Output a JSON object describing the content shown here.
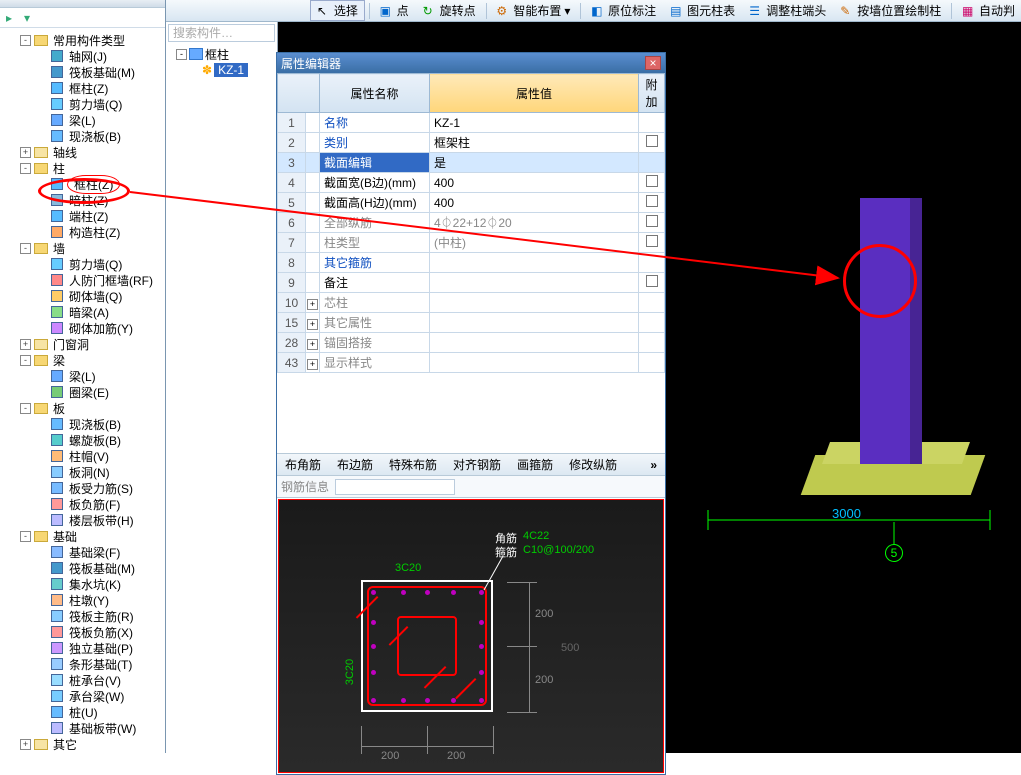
{
  "toolbar": {
    "select": "选择",
    "point": "点",
    "rotpoint": "旋转点",
    "smart": "智能布置",
    "origin": "原位标注",
    "metalist": "图元柱表",
    "adjust": "调整柱端头",
    "drawcol": "按墙位置绘制柱",
    "auto": "自动判"
  },
  "tree": [
    {
      "d": 1,
      "exp": "-",
      "ico": "fold-y",
      "lbl": "常用构件类型"
    },
    {
      "d": 2,
      "ico": "grid-b",
      "lbl": "轴网(J)"
    },
    {
      "d": 2,
      "ico": "raft-b",
      "lbl": "筏板基础(M)"
    },
    {
      "d": 2,
      "ico": "col-b",
      "lbl": "框柱(Z)"
    },
    {
      "d": 2,
      "ico": "wall-b",
      "lbl": "剪力墙(Q)"
    },
    {
      "d": 2,
      "ico": "beam-b",
      "lbl": "梁(L)"
    },
    {
      "d": 2,
      "ico": "slab-b",
      "lbl": "现浇板(B)"
    },
    {
      "d": 1,
      "exp": "+",
      "ico": "fold-c",
      "lbl": "轴线"
    },
    {
      "d": 1,
      "exp": "-",
      "ico": "fold-y",
      "lbl": "柱"
    },
    {
      "d": 2,
      "ico": "col-b",
      "lbl": "框柱(Z)",
      "hi": true
    },
    {
      "d": 2,
      "ico": "col-g",
      "lbl": "暗柱(Z)"
    },
    {
      "d": 2,
      "ico": "col-b",
      "lbl": "端柱(Z)"
    },
    {
      "d": 2,
      "ico": "col-o",
      "lbl": "构造柱(Z)"
    },
    {
      "d": 1,
      "exp": "-",
      "ico": "fold-y",
      "lbl": "墙"
    },
    {
      "d": 2,
      "ico": "wall-b",
      "lbl": "剪力墙(Q)"
    },
    {
      "d": 2,
      "ico": "wall-r",
      "lbl": "人防门框墙(RF)"
    },
    {
      "d": 2,
      "ico": "wall-y",
      "lbl": "砌体墙(Q)"
    },
    {
      "d": 2,
      "ico": "wall-g",
      "lbl": "暗梁(A)"
    },
    {
      "d": 2,
      "ico": "wall-p",
      "lbl": "砌体加筋(Y)"
    },
    {
      "d": 1,
      "exp": "+",
      "ico": "fold-c",
      "lbl": "门窗洞"
    },
    {
      "d": 1,
      "exp": "-",
      "ico": "fold-y",
      "lbl": "梁"
    },
    {
      "d": 2,
      "ico": "beam-b",
      "lbl": "梁(L)"
    },
    {
      "d": 2,
      "ico": "beam-g",
      "lbl": "圈梁(E)"
    },
    {
      "d": 1,
      "exp": "-",
      "ico": "fold-y",
      "lbl": "板"
    },
    {
      "d": 2,
      "ico": "slab-b",
      "lbl": "现浇板(B)"
    },
    {
      "d": 2,
      "ico": "slab-c",
      "lbl": "螺旋板(B)"
    },
    {
      "d": 2,
      "ico": "slab-h",
      "lbl": "柱帽(V)"
    },
    {
      "d": 2,
      "ico": "slab-o",
      "lbl": "板洞(N)"
    },
    {
      "d": 2,
      "ico": "slab-r",
      "lbl": "板受力筋(S)"
    },
    {
      "d": 2,
      "ico": "slab-n",
      "lbl": "板负筋(F)"
    },
    {
      "d": 2,
      "ico": "slab-s",
      "lbl": "楼层板带(H)"
    },
    {
      "d": 1,
      "exp": "-",
      "ico": "fold-y",
      "lbl": "基础"
    },
    {
      "d": 2,
      "ico": "fnd-b",
      "lbl": "基础梁(F)"
    },
    {
      "d": 2,
      "ico": "raft-b",
      "lbl": "筏板基础(M)"
    },
    {
      "d": 2,
      "ico": "fnd-s",
      "lbl": "集水坑(K)"
    },
    {
      "d": 2,
      "ico": "fnd-p",
      "lbl": "柱墩(Y)"
    },
    {
      "d": 2,
      "ico": "fnd-m",
      "lbl": "筏板主筋(R)"
    },
    {
      "d": 2,
      "ico": "fnd-n",
      "lbl": "筏板负筋(X)"
    },
    {
      "d": 2,
      "ico": "fnd-i",
      "lbl": "独立基础(P)"
    },
    {
      "d": 2,
      "ico": "fnd-t",
      "lbl": "条形基础(T)"
    },
    {
      "d": 2,
      "ico": "fnd-c",
      "lbl": "桩承台(V)"
    },
    {
      "d": 2,
      "ico": "fnd-cb",
      "lbl": "承台梁(W)"
    },
    {
      "d": 2,
      "ico": "fnd-z",
      "lbl": "桩(U)"
    },
    {
      "d": 2,
      "ico": "fnd-bd",
      "lbl": "基础板带(W)"
    },
    {
      "d": 1,
      "exp": "+",
      "ico": "fold-c",
      "lbl": "其它"
    }
  ],
  "mid": {
    "search_ph": "搜索构件…",
    "root": "框柱",
    "item": "KZ-1"
  },
  "prop": {
    "title": "属性编辑器",
    "h_name": "属性名称",
    "h_val": "属性值",
    "h_add": "附加",
    "rows": [
      {
        "n": "1",
        "name": "名称",
        "val": "KZ-1",
        "link": true
      },
      {
        "n": "2",
        "name": "类别",
        "val": "框架柱",
        "link": true,
        "chk": true
      },
      {
        "n": "3",
        "name": "截面编辑",
        "val": "是",
        "sel": true
      },
      {
        "n": "4",
        "name": "截面宽(B边)(mm)",
        "val": "400",
        "chk": true
      },
      {
        "n": "5",
        "name": "截面高(H边)(mm)",
        "val": "400",
        "chk": true
      },
      {
        "n": "6",
        "name": "全部纵筋",
        "val": "4⏀22+12⏀20",
        "grey": true,
        "chk": true
      },
      {
        "n": "7",
        "name": "柱类型",
        "val": "(中柱)",
        "grey": true,
        "chk": true
      },
      {
        "n": "8",
        "name": "其它箍筋",
        "val": "",
        "link": true
      },
      {
        "n": "9",
        "name": "备注",
        "val": "",
        "chk": true
      },
      {
        "n": "10",
        "name": "芯柱",
        "val": "",
        "xc": "+",
        "grey": true
      },
      {
        "n": "15",
        "name": "其它属性",
        "val": "",
        "xc": "+",
        "grey": true
      },
      {
        "n": "28",
        "name": "锚固搭接",
        "val": "",
        "xc": "+",
        "grey": true
      },
      {
        "n": "43",
        "name": "显示样式",
        "val": "",
        "xc": "+",
        "grey": true
      }
    ]
  },
  "section": {
    "tabs": [
      "布角筋",
      "布边筋",
      "特殊布筋",
      "对齐钢筋",
      "画箍筋",
      "修改纵筋"
    ],
    "info_lbl": "钢筋信息",
    "jiao": "角筋",
    "jiao_v": "4C22",
    "gu": "箍筋",
    "gu_v": "C10@100/200",
    "top_dim": "3C20",
    "left_dim": "3C20",
    "d200a": "200",
    "d200b": "200",
    "d200c": "200",
    "d200d": "200",
    "d500": "500"
  },
  "canvas": {
    "dim": "3000",
    "axis": "5"
  }
}
